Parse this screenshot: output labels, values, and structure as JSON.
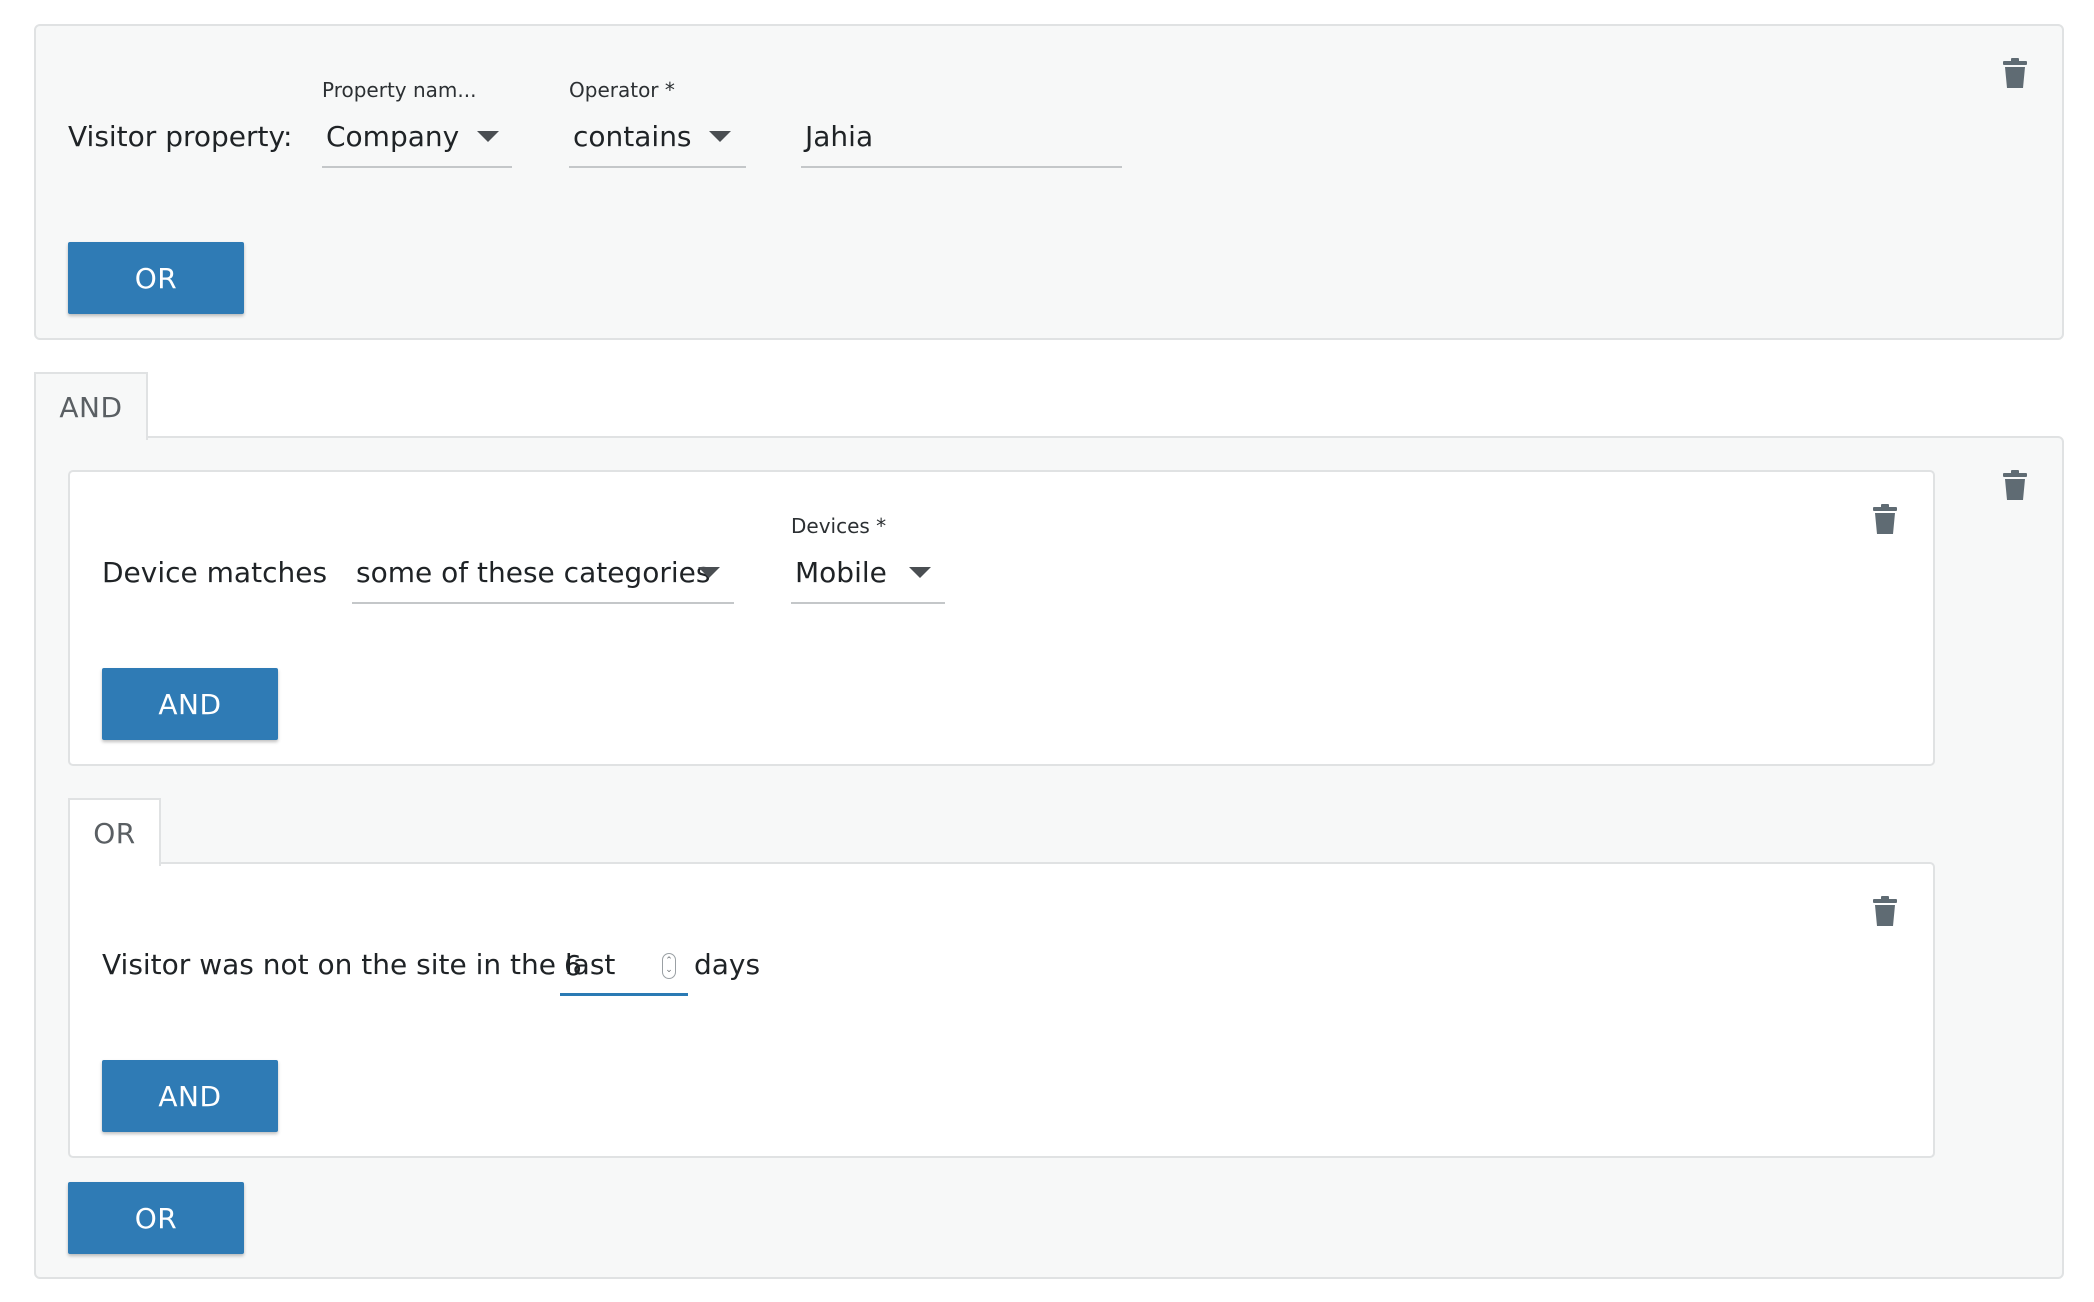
{
  "rule1": {
    "label": "Visitor property:",
    "property_field": {
      "label": "Property nam...",
      "value": "Company"
    },
    "operator_field": {
      "label": "Operator *",
      "value": "contains"
    },
    "value_field": {
      "value": "Jahia"
    },
    "or_button": "OR"
  },
  "and_tab": "AND",
  "group": {
    "rule_device": {
      "label": "Device matches",
      "match_field": {
        "value": "some of these categories"
      },
      "devices_field": {
        "label": "Devices *",
        "value": "Mobile"
      },
      "and_button": "AND"
    },
    "or_tab": "OR",
    "rule_visit": {
      "label_before": "Visitor was not on the site in the last",
      "days_value": "6",
      "label_after": "days",
      "and_button": "AND"
    },
    "or_button": "OR"
  },
  "icons": {
    "delete": "trash-icon",
    "dropdown": "caret-down-icon",
    "stepper": "number-stepper-icon"
  },
  "colors": {
    "button": "#2f7bb5",
    "panel_bg": "#f7f8f8",
    "border": "#e0e2e3",
    "focus_underline": "#2a7ab4"
  }
}
